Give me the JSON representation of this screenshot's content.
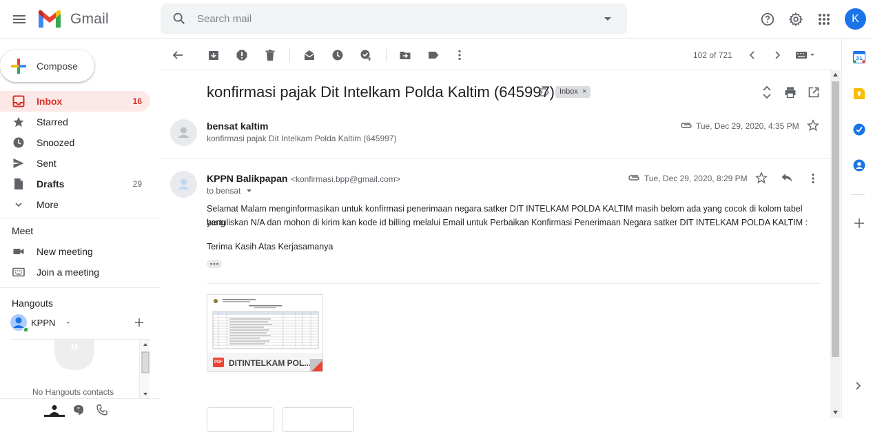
{
  "header": {
    "brand": "Gmail",
    "search_placeholder": "Search mail",
    "avatar_letter": "K"
  },
  "sidebar": {
    "compose_label": "Compose",
    "items": [
      {
        "label": "Inbox",
        "count": "16"
      },
      {
        "label": "Starred",
        "count": ""
      },
      {
        "label": "Snoozed",
        "count": ""
      },
      {
        "label": "Sent",
        "count": ""
      },
      {
        "label": "Drafts",
        "count": "29"
      },
      {
        "label": "More",
        "count": ""
      }
    ],
    "meet_title": "Meet",
    "meet_items": [
      {
        "label": "New meeting"
      },
      {
        "label": "Join a meeting"
      }
    ],
    "hangouts_title": "Hangouts",
    "hangouts_user": "KPPN",
    "no_contacts": "No Hangouts contacts"
  },
  "toolbar": {
    "pager": "102 of 721"
  },
  "thread": {
    "subject": "konfirmasi pajak Dit Intelkam Polda Kaltim (645997)",
    "label_chip": "Inbox",
    "messages": [
      {
        "sender": "bensat kaltim",
        "snippet": "konfirmasi pajak Dit Intelkam Polda Kaltim (645997)",
        "date": "Tue, Dec 29, 2020, 4:35 PM"
      },
      {
        "sender": "KPPN Balikpapan",
        "email": "<konfirmasi.bpp@gmail.com>",
        "to": "to bensat",
        "date": "Tue, Dec 29, 2020, 8:29 PM",
        "body_line1": "Selamat Malam menginformasikan untuk konfirmasi penerimaan negara satker DIT INTELKAM POLDA KALTIM masih belom ada yang cocok di kolom tabel yang",
        "body_line2": "bertuliskan N/A dan mohon di kirim kan kode id billing melalui Email untuk Perbaikan Konfirmasi Penerimaan Negara satker DIT INTELKAM POLDA KALTIM :",
        "body_closing": "Terima Kasih Atas Kerjasamanya",
        "attachment_name": "DITINTELKAM POL...",
        "attachment_type": "PDF"
      }
    ]
  },
  "colors": {
    "accent_red": "#d93025",
    "inbox_bg": "#fce8e6",
    "blue": "#1a73e8"
  }
}
